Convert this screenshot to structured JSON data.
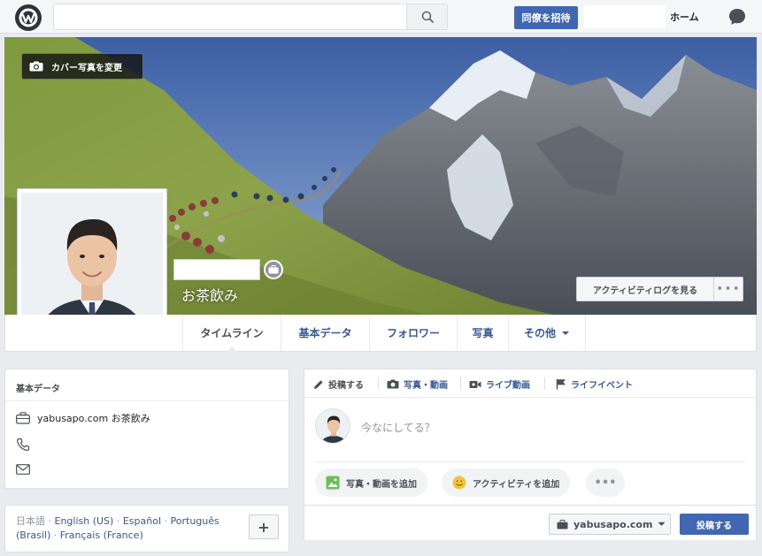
{
  "topbar": {
    "search_placeholder": "",
    "invite_label": "同僚を招待",
    "home_label": "ホーム"
  },
  "cover": {
    "change_cover_label": "カバー写真を変更",
    "activity_log_label": "アクティビティログを見る",
    "more_label": "•••"
  },
  "profile": {
    "subname": "お茶飲み"
  },
  "tabs": [
    {
      "label": "タイムライン"
    },
    {
      "label": "基本データ"
    },
    {
      "label": "フォロワー"
    },
    {
      "label": "写真"
    },
    {
      "label": "その他"
    }
  ],
  "about": {
    "title": "基本データ",
    "work": "yabusapo.com お茶飲み"
  },
  "languages": {
    "current": "日本語",
    "links": [
      "English (US)",
      "Español",
      "Português (Brasil)",
      "Français (France)"
    ],
    "add_label": "+"
  },
  "composer": {
    "tabs": [
      {
        "label": "投稿する"
      },
      {
        "label": "写真・動画"
      },
      {
        "label": "ライブ動画"
      },
      {
        "label": "ライフイベント"
      }
    ],
    "placeholder": "今なにしてる？",
    "photo_video_label": "写真・動画を追加",
    "activity_label": "アクティビティを追加",
    "more_label": "•••",
    "audience_label": "yabusapo.com",
    "post_label": "投稿する"
  },
  "colors": {
    "brand": "#4267b2",
    "link": "#365899",
    "background": "#e9ebee"
  }
}
